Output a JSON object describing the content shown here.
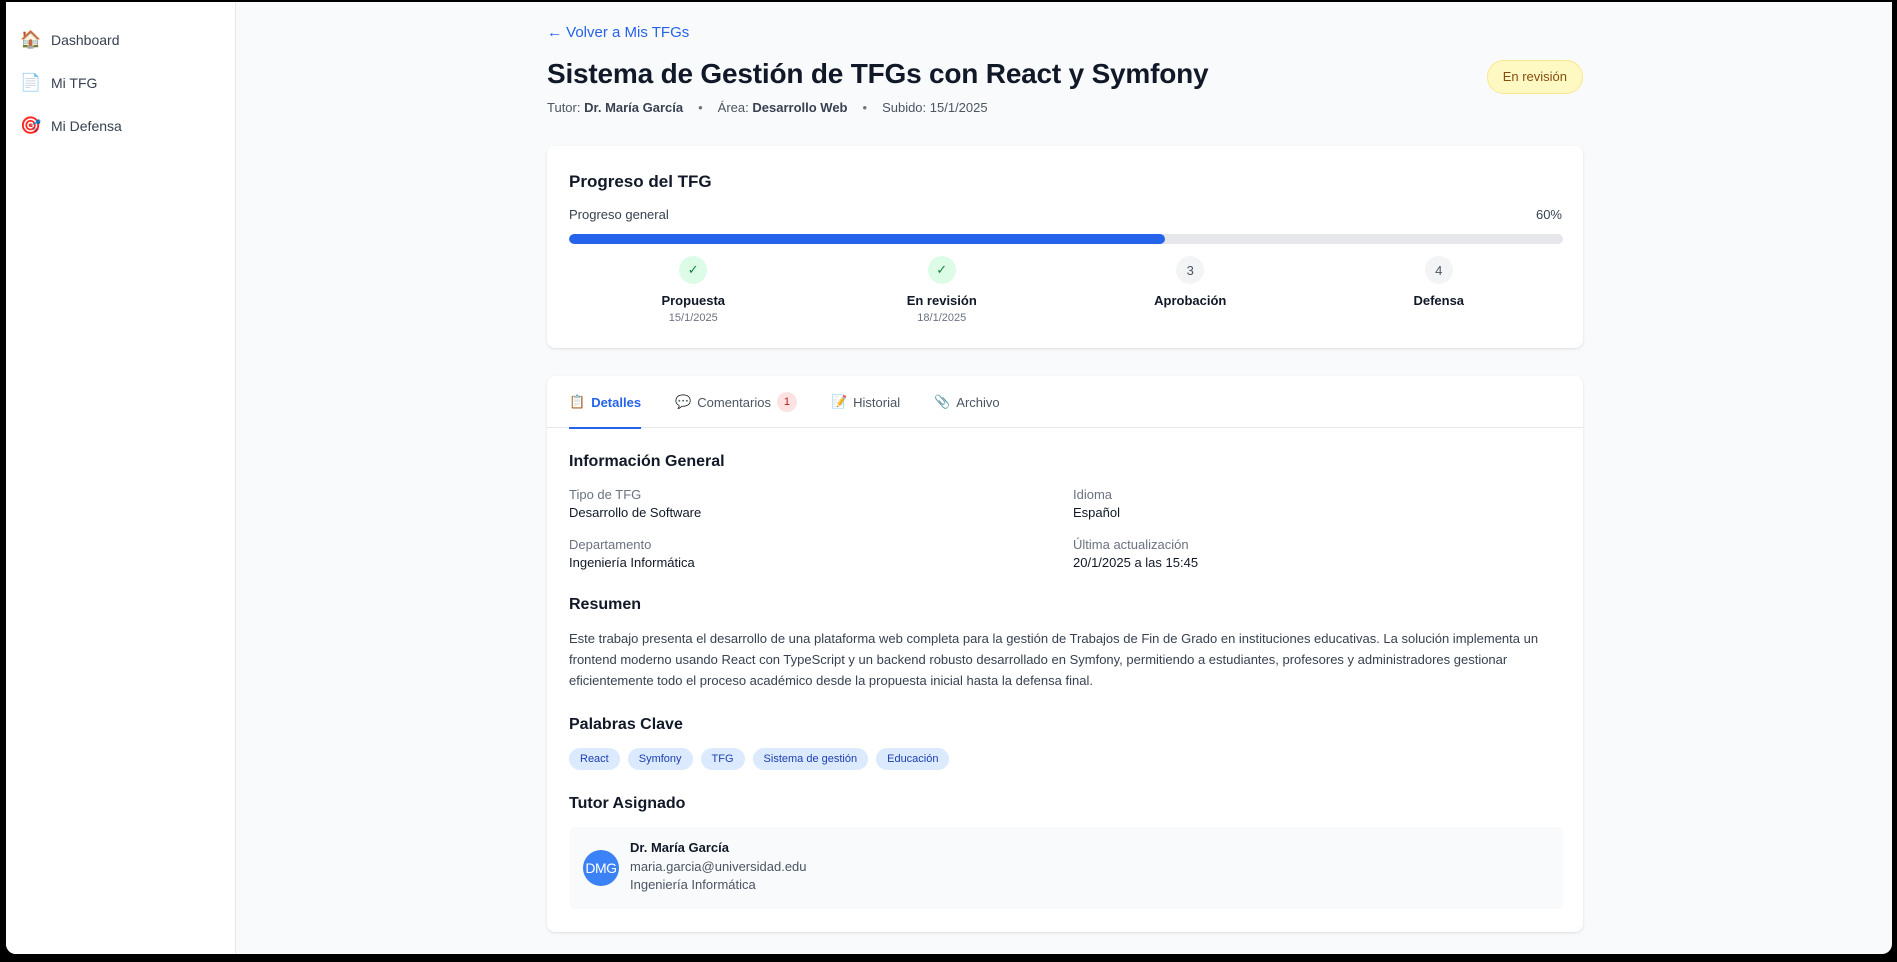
{
  "sidebar": {
    "items": [
      {
        "icon": "house-icon",
        "glyph": "🏠",
        "label": "Dashboard"
      },
      {
        "icon": "document-icon",
        "glyph": "📄",
        "label": "Mi TFG"
      },
      {
        "icon": "target-icon",
        "glyph": "🎯",
        "label": "Mi Defensa"
      }
    ]
  },
  "header": {
    "back_link": "← Volver a Mis TFGs",
    "title": "Sistema de Gestión de TFGs con React y Symfony",
    "status": "En revisión",
    "meta": {
      "tutor_label": "Tutor:",
      "tutor_value": "Dr. María García",
      "area_label": "Área:",
      "area_value": "Desarrollo Web",
      "uploaded": "Subido: 15/1/2025",
      "separator": "•"
    }
  },
  "progress": {
    "title": "Progreso del TFG",
    "label": "Progreso general",
    "value_label": "60%",
    "value": 0.6,
    "steps": [
      {
        "marker": "✓",
        "state": "done",
        "name": "Propuesta",
        "date": "15/1/2025"
      },
      {
        "marker": "✓",
        "state": "done",
        "name": "En revisión",
        "date": "18/1/2025"
      },
      {
        "marker": "3",
        "state": "pending",
        "name": "Aprobación",
        "date": ""
      },
      {
        "marker": "4",
        "state": "pending",
        "name": "Defensa",
        "date": ""
      }
    ]
  },
  "tabs": [
    {
      "glyph": "📋",
      "label": "Detalles",
      "active": true
    },
    {
      "glyph": "💬",
      "label": "Comentarios",
      "badge": "1"
    },
    {
      "glyph": "📝",
      "label": "Historial"
    },
    {
      "glyph": "📎",
      "label": "Archivo"
    }
  ],
  "details": {
    "general_title": "Información General",
    "fields": {
      "tipo_label": "Tipo de TFG",
      "tipo_value": "Desarrollo de Software",
      "idioma_label": "Idioma",
      "idioma_value": "Español",
      "departamento_label": "Departamento",
      "departamento_value": "Ingeniería Informática",
      "actualizacion_label": "Última actualización",
      "actualizacion_value": "20/1/2025 a las 15:45"
    },
    "resumen_title": "Resumen",
    "resumen_text": "Este trabajo presenta el desarrollo de una plataforma web completa para la gestión de Trabajos de Fin de Grado en instituciones educativas. La solución implementa un frontend moderno usando React con TypeScript y un backend robusto desarrollado en Symfony, permitiendo a estudiantes, profesores y administradores gestionar eficientemente todo el proceso académico desde la propuesta inicial hasta la defensa final.",
    "keywords_title": "Palabras Clave",
    "keywords": [
      "React",
      "Symfony",
      "TFG",
      "Sistema de gestión",
      "Educación"
    ],
    "tutor_title": "Tutor Asignado",
    "tutor": {
      "initials": "DMG",
      "name": "Dr. María García",
      "email": "maria.garcia@universidad.edu",
      "department": "Ingeniería Informática"
    }
  },
  "colors": {
    "accent": "#2563eb",
    "status_bg": "#fef9c3",
    "status_text": "#854d0e",
    "done_bg": "#dcfce7",
    "keyword_bg": "#dbeafe"
  }
}
